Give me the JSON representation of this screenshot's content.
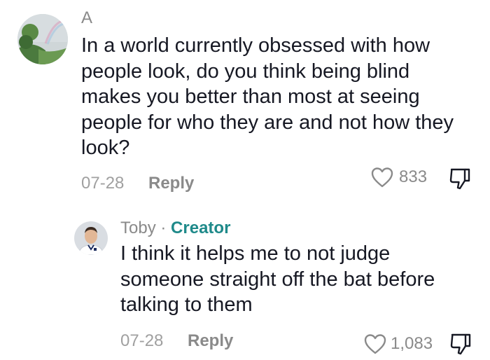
{
  "comments": [
    {
      "author": "A",
      "text": "In a world currently obsessed with how people look, do you think being blind makes you better than most at seeing people for who they are and not how they look?",
      "date": "07-28",
      "reply_label": "Reply",
      "likes": "833",
      "icons": {
        "like": "heart-outline-icon",
        "dislike": "thumbs-down-outline-icon"
      }
    },
    {
      "author": "Toby",
      "separator": "·",
      "badge": "Creator",
      "text": "I think it helps me to not judge someone straight off the bat before talking to them",
      "date": "07-28",
      "reply_label": "Reply",
      "likes": "1,083",
      "icons": {
        "like": "heart-outline-icon",
        "dislike": "thumbs-down-outline-icon"
      }
    }
  ],
  "colors": {
    "text": "#161823",
    "muted": "#8a8a8a",
    "creator_badge": "#1f8a8a"
  }
}
